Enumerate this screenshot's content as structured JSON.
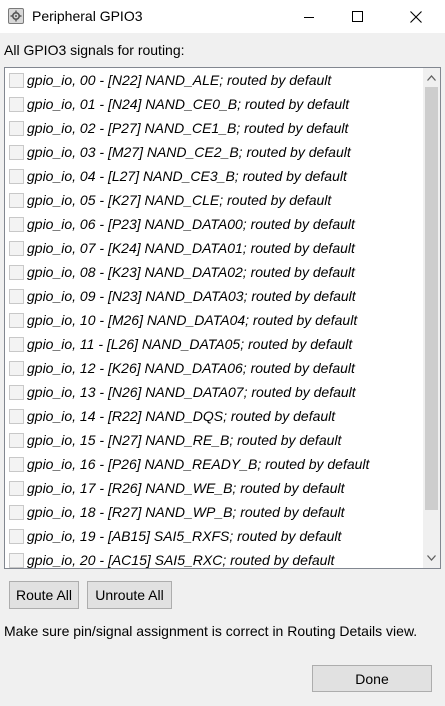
{
  "window": {
    "title": "Peripheral GPIO3",
    "icon": "peripheral-app-icon",
    "controls": [
      "minimize-icon",
      "maximize-icon",
      "close-icon"
    ]
  },
  "prompt": "All GPIO3 signals for routing:",
  "signals": [
    {
      "label": "gpio_io, 00 - [N22] NAND_ALE; routed by default",
      "checked": false
    },
    {
      "label": "gpio_io, 01 - [N24] NAND_CE0_B; routed by default",
      "checked": false
    },
    {
      "label": "gpio_io, 02 - [P27] NAND_CE1_B; routed by default",
      "checked": false
    },
    {
      "label": "gpio_io, 03 - [M27] NAND_CE2_B; routed by default",
      "checked": false
    },
    {
      "label": "gpio_io, 04 - [L27] NAND_CE3_B; routed by default",
      "checked": false
    },
    {
      "label": "gpio_io, 05 - [K27] NAND_CLE; routed by default",
      "checked": false
    },
    {
      "label": "gpio_io, 06 - [P23] NAND_DATA00; routed by default",
      "checked": false
    },
    {
      "label": "gpio_io, 07 - [K24] NAND_DATA01; routed by default",
      "checked": false
    },
    {
      "label": "gpio_io, 08 - [K23] NAND_DATA02; routed by default",
      "checked": false
    },
    {
      "label": "gpio_io, 09 - [N23] NAND_DATA03; routed by default",
      "checked": false
    },
    {
      "label": "gpio_io, 10 - [M26] NAND_DATA04; routed by default",
      "checked": false
    },
    {
      "label": "gpio_io, 11 - [L26] NAND_DATA05; routed by default",
      "checked": false
    },
    {
      "label": "gpio_io, 12 - [K26] NAND_DATA06; routed by default",
      "checked": false
    },
    {
      "label": "gpio_io, 13 - [N26] NAND_DATA07; routed by default",
      "checked": false
    },
    {
      "label": "gpio_io, 14 - [R22] NAND_DQS; routed by default",
      "checked": false
    },
    {
      "label": "gpio_io, 15 - [N27] NAND_RE_B; routed by default",
      "checked": false
    },
    {
      "label": "gpio_io, 16 - [P26] NAND_READY_B; routed by default",
      "checked": false
    },
    {
      "label": "gpio_io, 17 - [R26] NAND_WE_B; routed by default",
      "checked": false
    },
    {
      "label": "gpio_io, 18 - [R27] NAND_WP_B; routed by default",
      "checked": false
    },
    {
      "label": "gpio_io, 19 - [AB15] SAI5_RXFS; routed by default",
      "checked": false
    },
    {
      "label": "gpio_io, 20 - [AC15] SAI5_RXC; routed by default",
      "checked": false
    }
  ],
  "buttons": {
    "route_all": "Route All",
    "unroute_all": "Unroute All",
    "done": "Done"
  },
  "note": "Make sure pin/signal assignment is correct in Routing Details view.",
  "colors": {
    "dialog_bg": "#f0f0f0",
    "list_bg": "#ffffff",
    "button_bg": "#e1e1e1",
    "scrollbar_thumb": "#cdcdcd"
  }
}
